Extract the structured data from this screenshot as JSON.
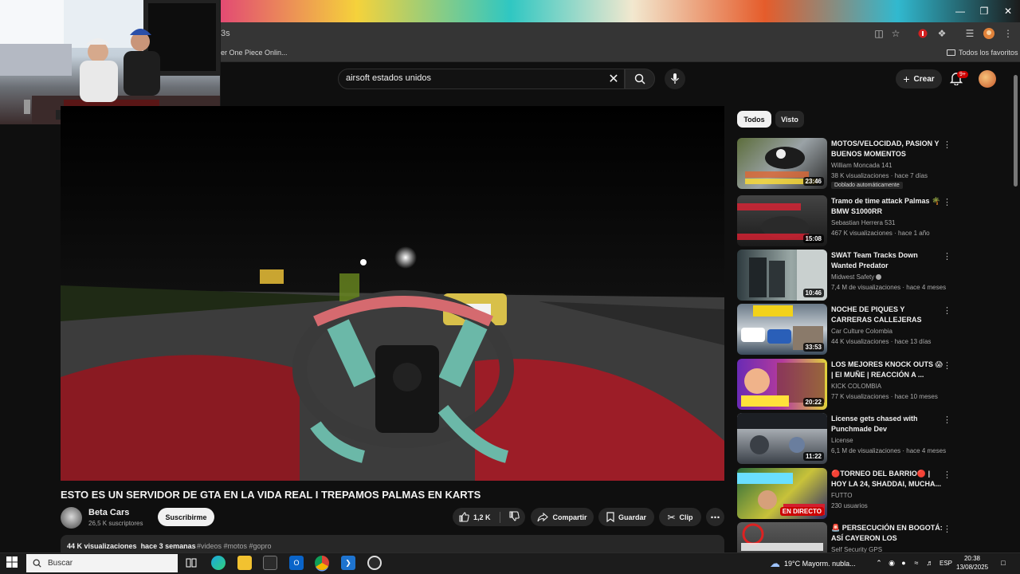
{
  "browser": {
    "url_fragment": "3s",
    "bookmarks": {
      "onepiece": "er One Piece Onlin...",
      "favorites": "Todos los favoritos"
    }
  },
  "youtube": {
    "search": {
      "value": "airsoft estados unidos"
    },
    "create_label": "Crear",
    "notifications_badge": "9+"
  },
  "video": {
    "title": "ESTO ES UN SERVIDOR DE GTA EN LA VIDA REAL I TREPAMOS PALMAS EN KARTS",
    "channel": "Beta Cars",
    "subscribers": "26,5 K suscriptores",
    "subscribe_label": "Suscribirme",
    "likes": "1,2 K",
    "share_label": "Compartir",
    "save_label": "Guardar",
    "clip_label": "Clip",
    "views": "44 K visualizaciones",
    "age": "hace 3 semanas",
    "tags": "#videos #motos #gopro"
  },
  "sidebar": {
    "chips": [
      "Todos",
      "Visto"
    ],
    "recommendations": [
      {
        "title": "MOTOS/VELOCIDAD, PASION Y BUENOS MOMENTOS",
        "channel": "William Moncada 141",
        "meta": "38 K visualizaciones · hace 7 días",
        "duration": "23:46",
        "badge": "Doblado automáticamente"
      },
      {
        "title": "Tramo de time attack Palmas 🌴 BMW S1000RR",
        "channel": "Sebastian Herrera 531",
        "meta": "467 K visualizaciones · hace 1 año",
        "duration": "15:08"
      },
      {
        "title": "SWAT Team Tracks Down Wanted Predator",
        "channel": "Midwest Safety",
        "meta": "7,4 M de visualizaciones · hace 4 meses",
        "duration": "10:46"
      },
      {
        "title": "NOCHE DE PIQUES Y CARRERAS CALLEJERAS SAL...",
        "channel": "Car Culture Colombia",
        "meta": "44 K visualizaciones · hace 13 días",
        "duration": "33:53"
      },
      {
        "title": "LOS MEJORES KNOCK OUTS 😱 | El MUÑE | REACCIÓN A ...",
        "channel": "KICK COLOMBIA",
        "meta": "77 K visualizaciones · hace 10 meses",
        "duration": "20:22"
      },
      {
        "title": "License gets chased with Punchmade Dev",
        "channel": "License",
        "meta": "6,1 M de visualizaciones · hace 4 meses",
        "duration": "11:22"
      },
      {
        "title": "🔴TORNEO DEL BARRIO🔴 | HOY LA 24, SHADDAI, MUCHA...",
        "channel": "FUTTO",
        "meta": "230 usuarios",
        "duration": "EN DIRECTO"
      },
      {
        "title": "🚨 PERSECUCIÓN EN BOGOTÁ: ASÍ CAYERON LOS PRESUNTO...",
        "channel": "Self Security GPS",
        "meta": "",
        "duration": ""
      }
    ]
  },
  "taskbar": {
    "search_label": "Buscar",
    "weather": "19°C  Mayorm. nubla...",
    "lang": "ESP",
    "time": "20:38",
    "date": "13/08/2025"
  }
}
